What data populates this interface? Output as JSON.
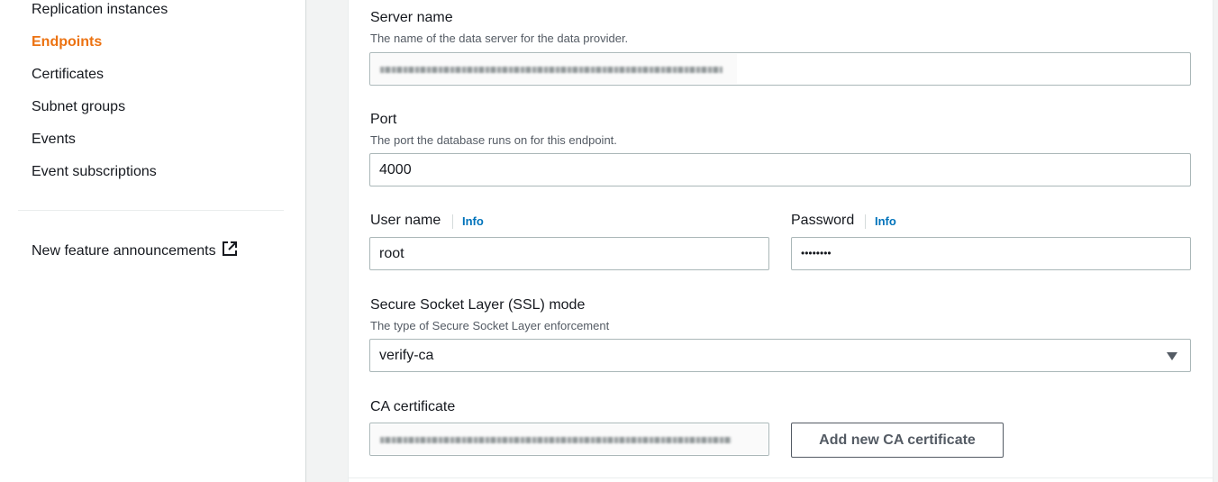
{
  "sidebar": {
    "items": [
      {
        "label": "Replication instances"
      },
      {
        "label": "Endpoints"
      },
      {
        "label": "Certificates"
      },
      {
        "label": "Subnet groups"
      },
      {
        "label": "Events"
      },
      {
        "label": "Event subscriptions"
      }
    ],
    "announcements": {
      "label": "New feature announcements",
      "icon": "external-link-icon"
    },
    "active_color": "#ec7211"
  },
  "form": {
    "server_name": {
      "label": "Server name",
      "description": "The name of the data server for the data provider."
    },
    "port": {
      "label": "Port",
      "description": "The port the database runs on for this endpoint.",
      "value": "4000"
    },
    "user_name": {
      "label": "User name",
      "info": "Info",
      "value": "root"
    },
    "password": {
      "label": "Password",
      "info": "Info",
      "value": "••••••••"
    },
    "ssl_mode": {
      "label": "Secure Socket Layer (SSL) mode",
      "description": "The type of Secure Socket Layer enforcement",
      "value": "verify-ca",
      "icon": "caret-down-icon"
    },
    "ca_certificate": {
      "label": "CA certificate",
      "add_button": "Add new CA certificate"
    }
  },
  "colors": {
    "link": "#0073bb",
    "border": "#aab7b8"
  }
}
